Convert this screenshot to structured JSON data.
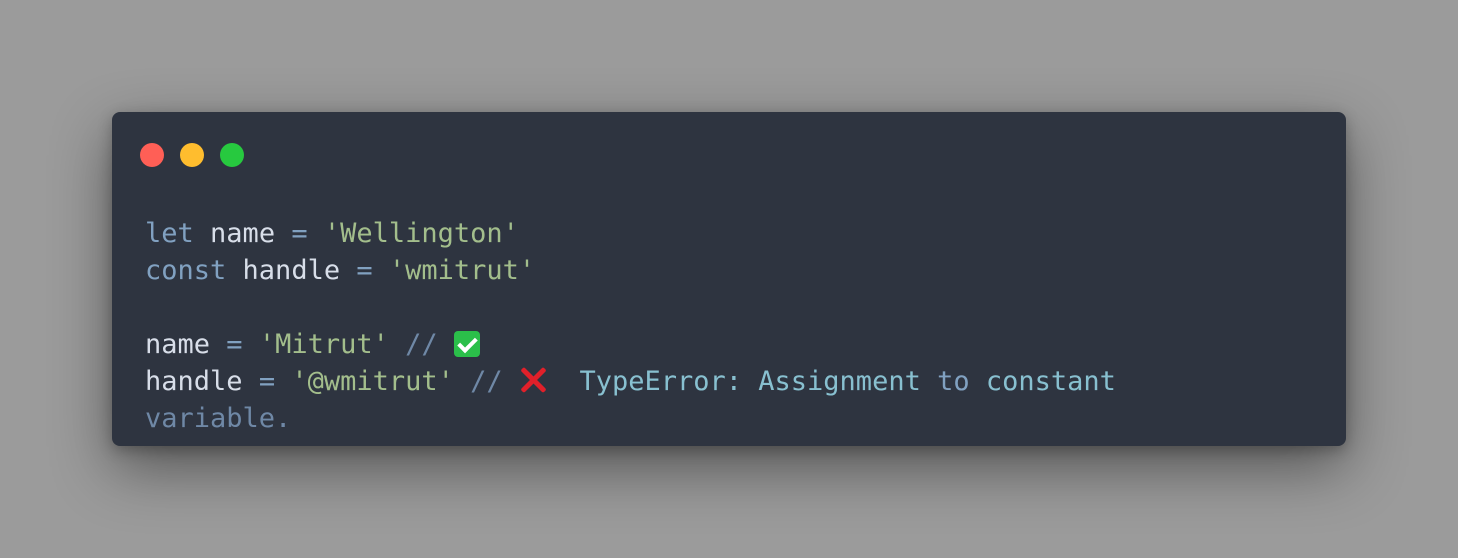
{
  "window": {
    "controls": [
      {
        "name": "close",
        "color": "#ff5f56"
      },
      {
        "name": "minimize",
        "color": "#ffbd2e"
      },
      {
        "name": "zoom",
        "color": "#27c93f"
      }
    ]
  },
  "code": {
    "line1": {
      "kw": "let",
      "id": "name",
      "op": "=",
      "str": "'Wellington'"
    },
    "line2": {
      "kw": "const",
      "id": "handle",
      "op": "=",
      "str": "'wmitrut'"
    },
    "line3": {
      "id": "name",
      "op": "=",
      "str": "'Mitrut'",
      "comment": "//",
      "icon": "check-mark-icon"
    },
    "line4": {
      "id": "handle",
      "op": "=",
      "str": "'@wmitrut'",
      "comment": "//",
      "icon": "cross-mark-icon",
      "error_a": "TypeError: Assignment",
      "error_to": "to",
      "error_b": "constant",
      "error_wrap": "variable."
    }
  },
  "colors": {
    "background": "#9b9b9b",
    "editor": "#2e3440",
    "keyword": "#81a1c1",
    "identifier": "#d8dee9",
    "string": "#a3be8c",
    "comment": "#6f88a6"
  }
}
